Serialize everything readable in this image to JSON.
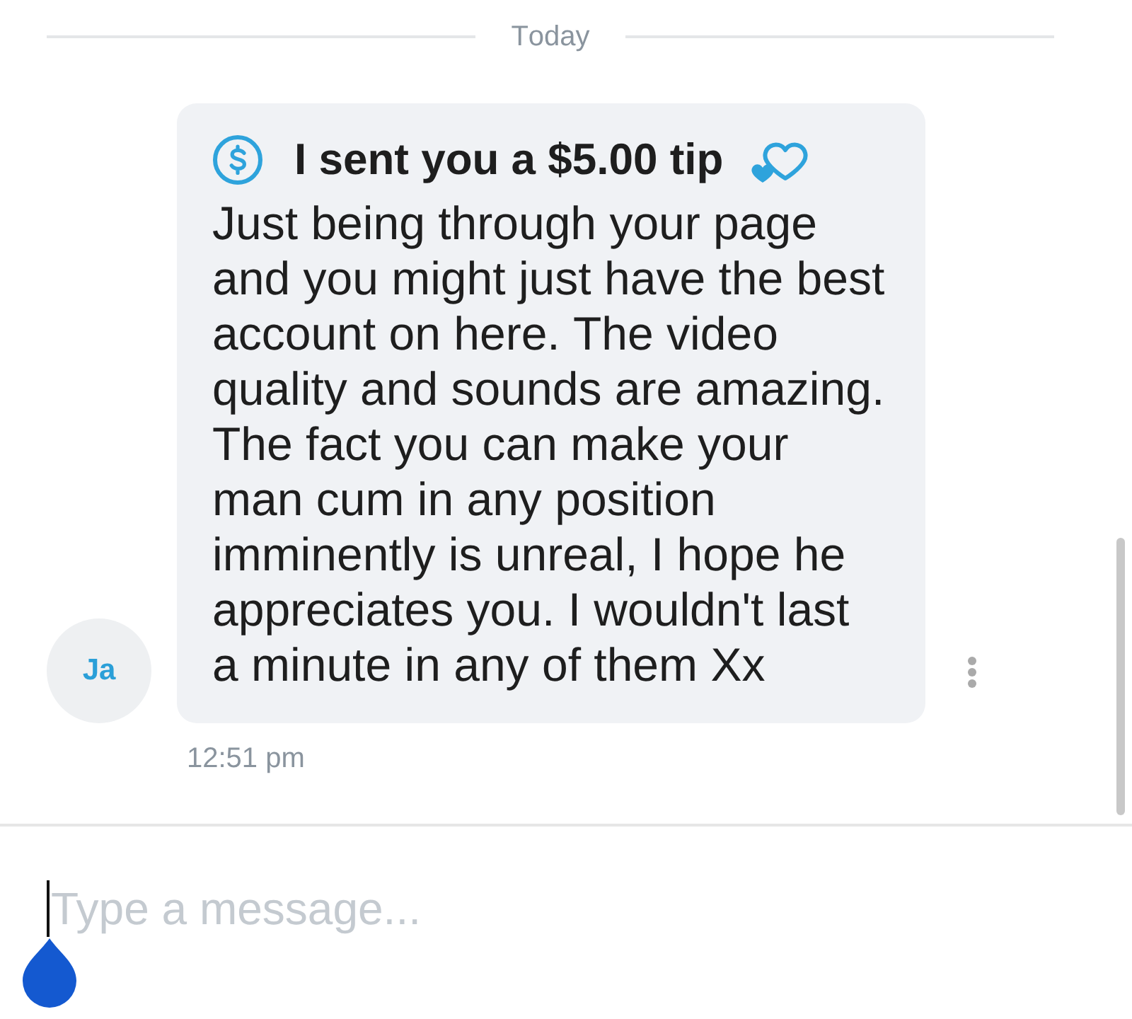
{
  "date_divider": {
    "label": "Today"
  },
  "messages": [
    {
      "avatar": {
        "initials": "Ja"
      },
      "tip": {
        "text": "I sent you a $5.00 tip"
      },
      "body": "Just being through your page and you might just have the best account on here. The video quality and sounds are amazing. The fact you can make your man cum in any position imminently is unreal, I hope he appreciates you. I wouldn't last a minute in any of them Xx",
      "time": "12:51 pm"
    }
  ],
  "composer": {
    "placeholder": "Type a message...",
    "focused": true
  }
}
